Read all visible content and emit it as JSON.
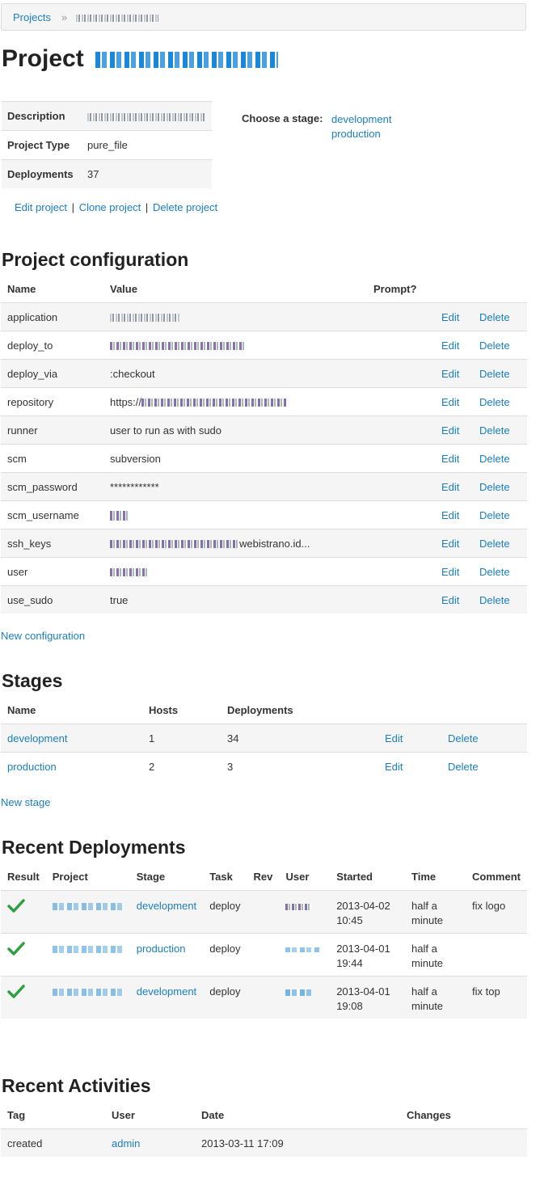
{
  "breadcrumb": {
    "projects": "Projects",
    "separator": "»"
  },
  "page": {
    "title_prefix": "Project"
  },
  "info": {
    "rows": [
      {
        "label": "Description",
        "value": ""
      },
      {
        "label": "Project Type",
        "value": "pure_file"
      },
      {
        "label": "Deployments",
        "value": "37"
      }
    ]
  },
  "stage_chooser": {
    "label": "Choose a stage:",
    "options": [
      "development",
      "production"
    ]
  },
  "project_actions": {
    "edit": "Edit project",
    "clone": "Clone project",
    "delete": "Delete project",
    "sep": "|"
  },
  "configuration": {
    "heading": "Project configuration",
    "columns": {
      "name": "Name",
      "value": "Value",
      "prompt": "Prompt?"
    },
    "rows": [
      {
        "name": "application",
        "value": ""
      },
      {
        "name": "deploy_to",
        "value": ""
      },
      {
        "name": "deploy_via",
        "value": ":checkout"
      },
      {
        "name": "repository",
        "value": "https://"
      },
      {
        "name": "runner",
        "value": "user to run as with sudo"
      },
      {
        "name": "scm",
        "value": "subversion"
      },
      {
        "name": "scm_password",
        "value": "************"
      },
      {
        "name": "scm_username",
        "value": ""
      },
      {
        "name": "ssh_keys",
        "value": "webistrano.id..."
      },
      {
        "name": "user",
        "value": ""
      },
      {
        "name": "use_sudo",
        "value": "true"
      }
    ],
    "edit_label": "Edit",
    "delete_label": "Delete",
    "new_link": "New configuration"
  },
  "stages": {
    "heading": "Stages",
    "columns": {
      "name": "Name",
      "hosts": "Hosts",
      "deployments": "Deployments"
    },
    "rows": [
      {
        "name": "development",
        "hosts": "1",
        "deployments": "34"
      },
      {
        "name": "production",
        "hosts": "2",
        "deployments": "3"
      }
    ],
    "edit_label": "Edit",
    "delete_label": "Delete",
    "new_link": "New stage"
  },
  "deployments": {
    "heading": "Recent Deployments",
    "columns": {
      "result": "Result",
      "project": "Project",
      "stage": "Stage",
      "task": "Task",
      "rev": "Rev",
      "user": "User",
      "started": "Started",
      "time": "Time",
      "comment": "Comment"
    },
    "rows": [
      {
        "stage": "development",
        "task": "deploy",
        "rev": "",
        "started_date": "2013-04-02",
        "started_time": "10:45",
        "time_1": "half a",
        "time_2": "minute",
        "comment": "fix logo"
      },
      {
        "stage": "production",
        "task": "deploy",
        "rev": "",
        "started_date": "2013-04-01",
        "started_time": "19:44",
        "time_1": "half a",
        "time_2": "minute",
        "comment": ""
      },
      {
        "stage": "development",
        "task": "deploy",
        "rev": "",
        "started_date": "2013-04-01",
        "started_time": "19:08",
        "time_1": "half a",
        "time_2": "minute",
        "comment": "fix top"
      }
    ],
    "success_color": "#2e9e3e"
  },
  "activities": {
    "heading": "Recent Activities",
    "columns": {
      "tag": "Tag",
      "user": "User",
      "date": "Date",
      "changes": "Changes"
    },
    "rows": [
      {
        "tag": "created",
        "user": "admin",
        "date": "2013-03-11 17:09",
        "changes": ""
      }
    ]
  }
}
